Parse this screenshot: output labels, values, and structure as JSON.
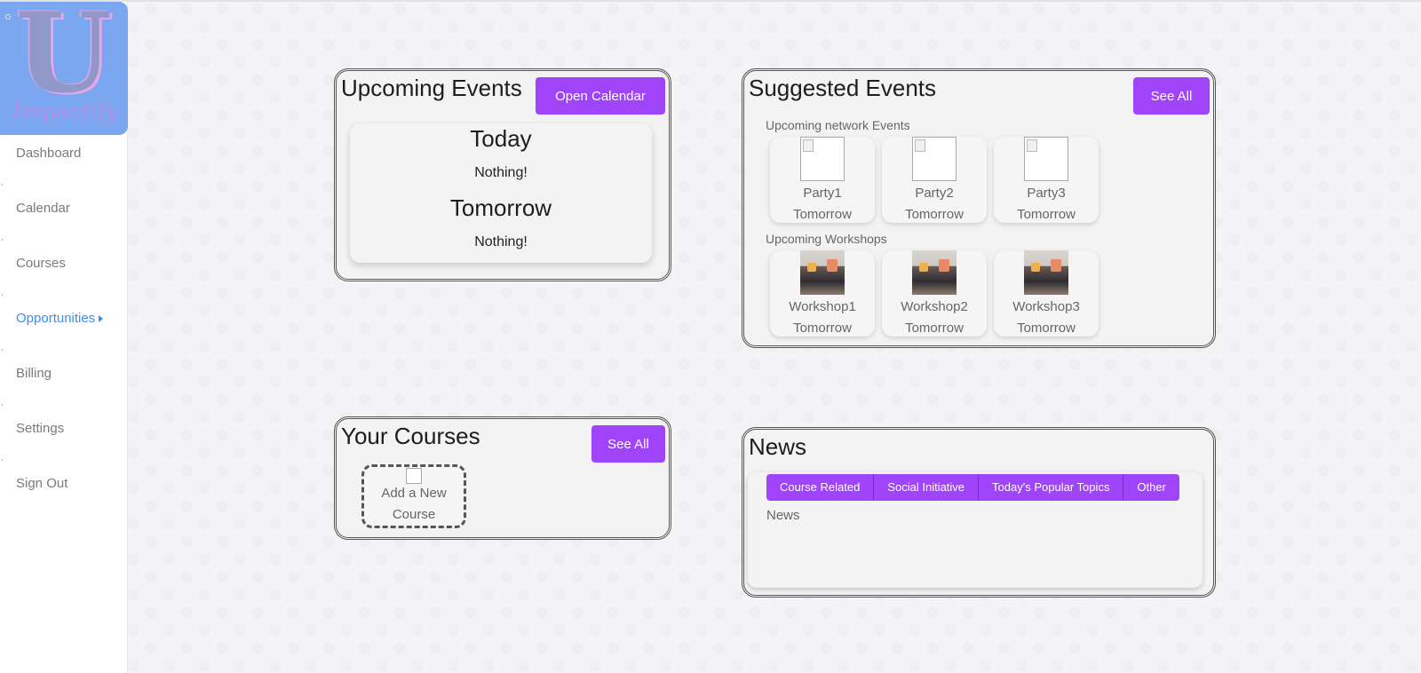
{
  "app": {
    "logo_letter": "U",
    "logo_word": "Impactify"
  },
  "sidebar": {
    "items": [
      {
        "label": "Dashboard"
      },
      {
        "label": "Calendar"
      },
      {
        "label": "Courses"
      },
      {
        "label": "Opportunities"
      },
      {
        "label": "Billing"
      },
      {
        "label": "Settings"
      },
      {
        "label": "Sign Out"
      }
    ],
    "active": "Opportunities"
  },
  "upcoming_events": {
    "title": "Upcoming Events",
    "button": "Open Calendar",
    "today_label": "Today",
    "today_value": "Nothing!",
    "tomorrow_label": "Tomorrow",
    "tomorrow_value": "Nothing!"
  },
  "suggested_events": {
    "title": "Suggested Events",
    "button": "See All",
    "network_label": "Upcoming network Events",
    "network": [
      {
        "name": "Party1",
        "when": "Tomorrow"
      },
      {
        "name": "Party2",
        "when": "Tomorrow"
      },
      {
        "name": "Party3",
        "when": "Tomorrow"
      }
    ],
    "workshops_label": "Upcoming Workshops",
    "workshops": [
      {
        "name": "Workshop1",
        "when": "Tomorrow"
      },
      {
        "name": "Workshop2",
        "when": "Tomorrow"
      },
      {
        "name": "Workshop3",
        "when": "Tomorrow"
      }
    ]
  },
  "courses": {
    "title": "Your Courses",
    "button": "See All",
    "add_label": "Add a New Course"
  },
  "news": {
    "title": "News",
    "tabs": [
      {
        "label": "Course Related"
      },
      {
        "label": "Social Initiative"
      },
      {
        "label": "Today's Popular Topics"
      },
      {
        "label": "Other"
      }
    ],
    "content_label": "News"
  },
  "colors": {
    "accent": "#a044fa",
    "active_link": "#3d8ef0",
    "logo_bg": "#7ba6f0"
  }
}
